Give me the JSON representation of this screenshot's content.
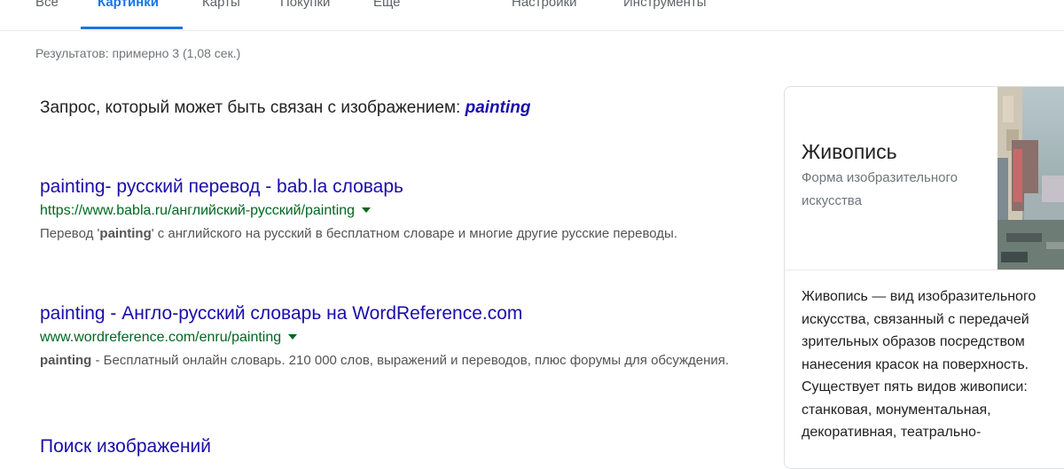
{
  "tabs": [
    {
      "label": "Все",
      "active": false
    },
    {
      "label": "Картинки",
      "active": true
    },
    {
      "label": "Карты",
      "active": false
    },
    {
      "label": "Покупки",
      "active": false
    },
    {
      "label": "Еще",
      "active": false
    },
    {
      "label": "Настройки",
      "active": false
    },
    {
      "label": "Инструменты",
      "active": false
    }
  ],
  "stats": "Результатов: примерно 3 (1,08 сек.)",
  "related": {
    "prefix": "Запрос, который может быть связан с изображением: ",
    "query": "painting"
  },
  "results": [
    {
      "title": "painting- русский перевод - bab.la словарь",
      "url": "https://www.babla.ru/английский-русский/painting",
      "snippet_before": "Перевод '",
      "snippet_bold": "painting",
      "snippet_after": "' с английского на русский в бесплатном словаре и многие другие русские переводы."
    },
    {
      "title": "painting - Англо-русский словарь на WordReference.com",
      "url": "www.wordreference.com/enru/painting",
      "snippet_before": "",
      "snippet_bold": "painting",
      "snippet_after": " - Бесплатный онлайн словарь. 210 000 слов, выражений и переводов, плюс форумы для обсуждения."
    }
  ],
  "cut_off_title": "Поиск изображений",
  "knowledge_panel": {
    "title": "Живопись",
    "subtitle": "Форма изобразительного искусства",
    "description": "Живопись — вид изобразительного искусства, связанный с передачей зрительных образов посредством нанесения красок на поверхность. Существует пять видов живописи: станковая, монументальная, декоративная, театрально-"
  },
  "colors": {
    "link": "#1a0dab",
    "url": "#006621",
    "accent": "#1a73e8"
  }
}
